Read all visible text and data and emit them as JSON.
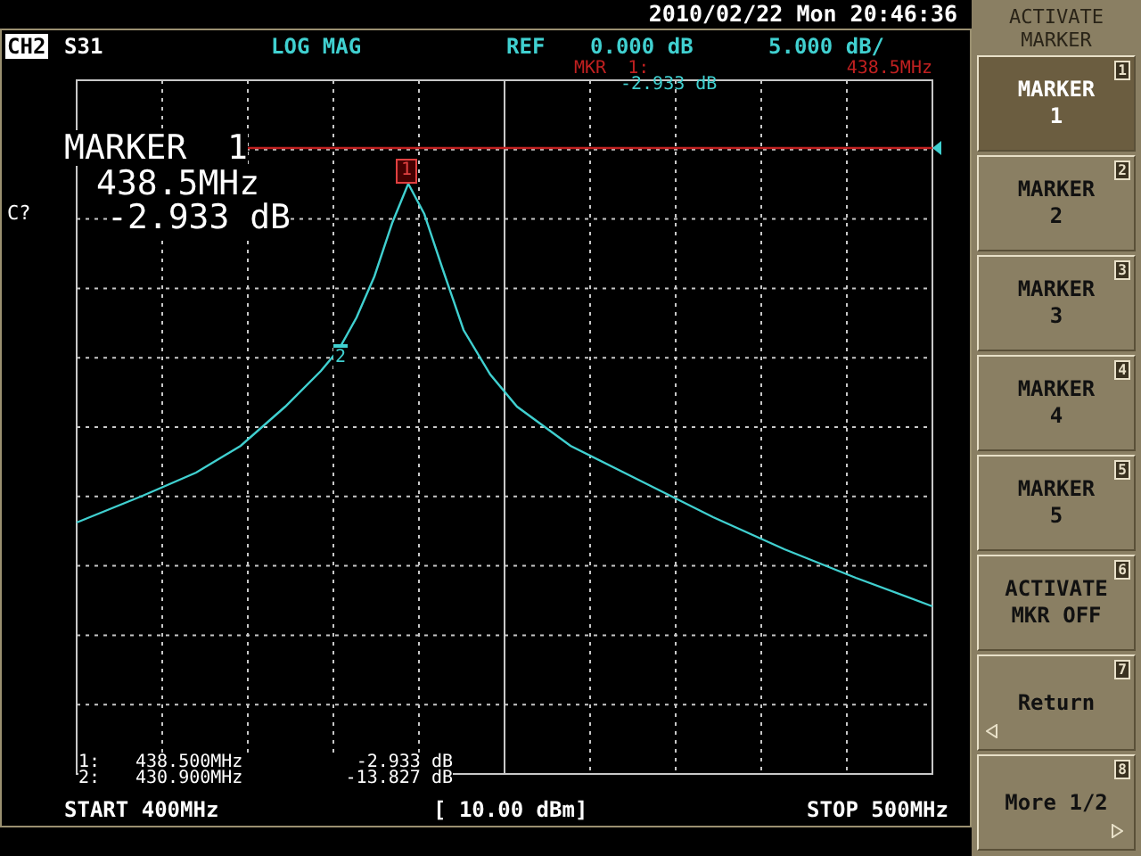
{
  "header": {
    "datetime": "2010/02/22 Mon 20:46:36"
  },
  "channel": {
    "label": "CH2",
    "parameter": "S31",
    "format": "LOG MAG",
    "ref_label": "REF",
    "ref_value": "0.000 dB",
    "scale": "5.000 dB/"
  },
  "marker_readout": {
    "label": "MKR  1:",
    "frequency": "438.5MHz",
    "value": "-2.933 dB"
  },
  "active_marker": {
    "title": "MARKER  1",
    "frequency": "438.5MHz",
    "value": "-2.933 dB"
  },
  "status_flag": "C?",
  "trace_markers": [
    {
      "label": "1",
      "selected": true
    },
    {
      "label": "2",
      "selected": false
    }
  ],
  "marker_table": [
    {
      "index": "1:",
      "frequency": "438.500MHz",
      "value": "-2.933 dB"
    },
    {
      "index": "2:",
      "frequency": "430.900MHz",
      "value": "-13.827 dB"
    }
  ],
  "footer": {
    "start": "START 400MHz",
    "power": "[ 10.00 dBm]",
    "stop": "STOP 500MHz"
  },
  "softkeys": {
    "title": [
      "ACTIVATE",
      "MARKER"
    ],
    "keys": [
      {
        "lines": [
          "MARKER",
          "1"
        ],
        "number": "1",
        "selected": true,
        "kind": "plain"
      },
      {
        "lines": [
          "MARKER",
          "2"
        ],
        "number": "2",
        "selected": false,
        "kind": "plain"
      },
      {
        "lines": [
          "MARKER",
          "3"
        ],
        "number": "3",
        "selected": false,
        "kind": "plain"
      },
      {
        "lines": [
          "MARKER",
          "4"
        ],
        "number": "4",
        "selected": false,
        "kind": "plain"
      },
      {
        "lines": [
          "MARKER",
          "5"
        ],
        "number": "5",
        "selected": false,
        "kind": "plain"
      },
      {
        "lines": [
          "ACTIVATE",
          "MKR OFF"
        ],
        "number": "6",
        "selected": false,
        "kind": "plain"
      },
      {
        "lines": [
          "Return"
        ],
        "number": "7",
        "selected": false,
        "kind": "back"
      },
      {
        "lines": [
          "More 1/2"
        ],
        "number": "8",
        "selected": false,
        "kind": "forward"
      }
    ]
  }
}
